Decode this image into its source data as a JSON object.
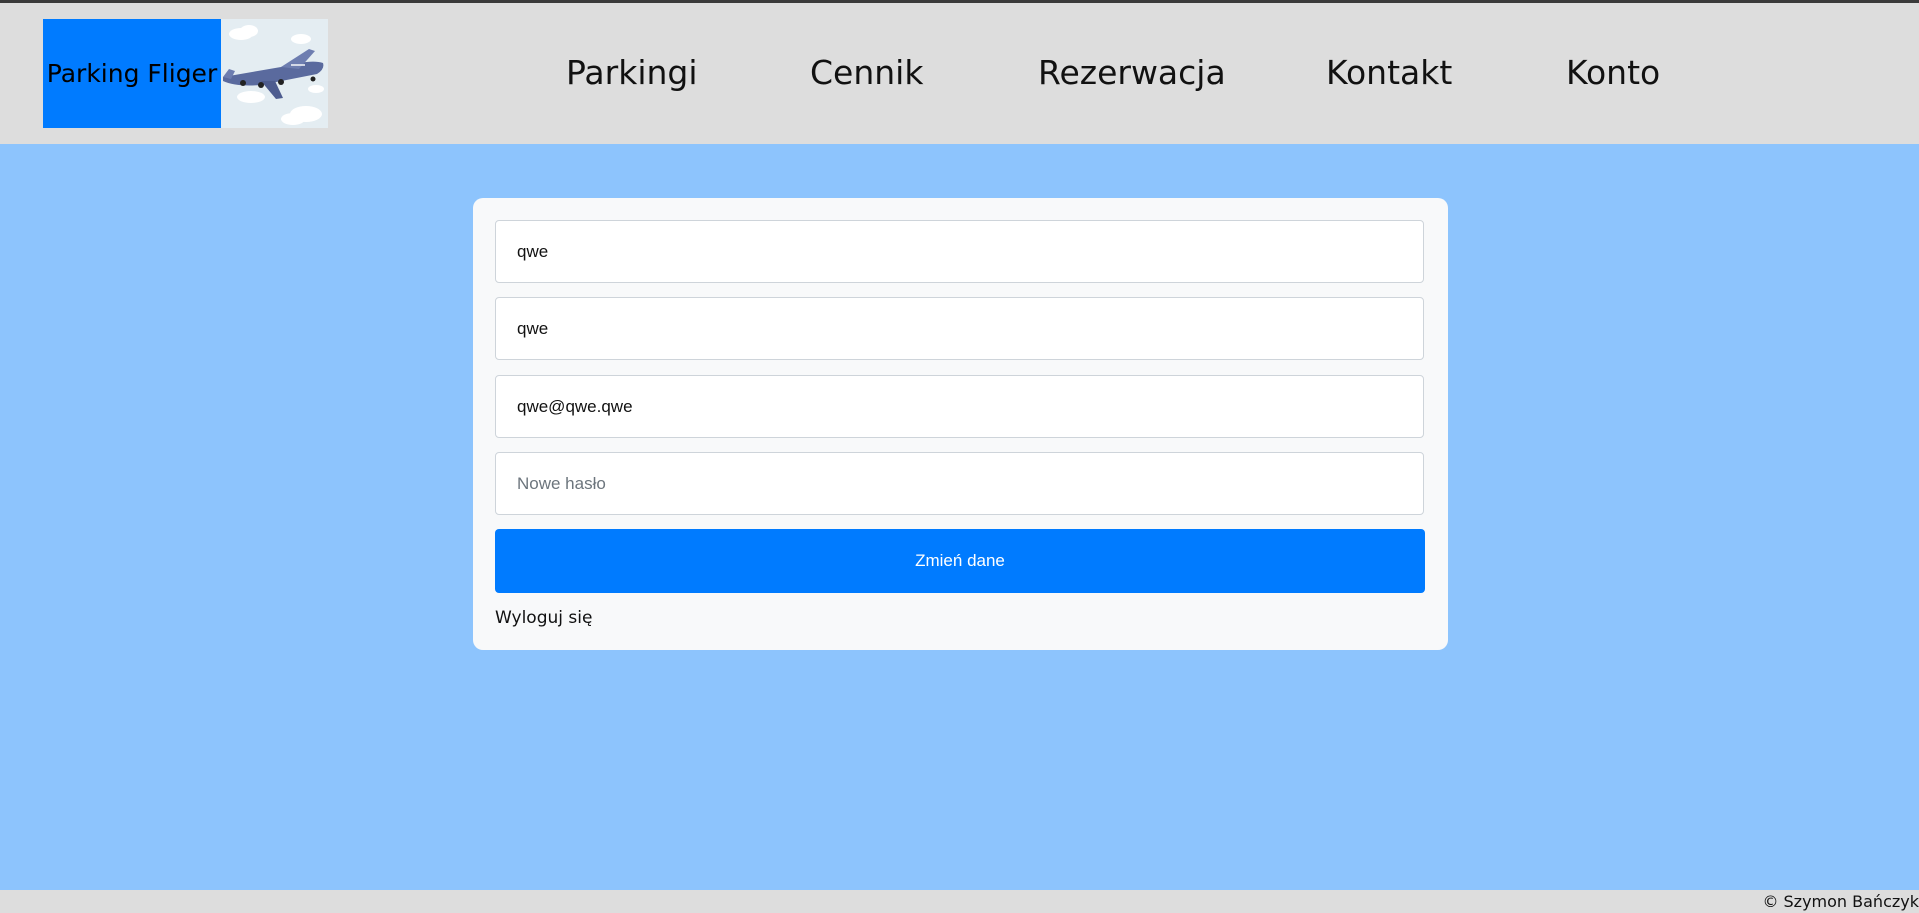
{
  "header": {
    "logo_text": "Parking Fliger",
    "nav": [
      "Parkingi",
      "Cennik",
      "Rezerwacja",
      "Kontakt",
      "Konto"
    ]
  },
  "form": {
    "first_name_value": "qwe",
    "last_name_value": "qwe",
    "email_value": "qwe@qwe.qwe",
    "password_placeholder": "Nowe hasło",
    "submit_label": "Zmień dane",
    "logout_label": "Wyloguj się"
  },
  "footer": {
    "copyright": "© Szymon Bańczyk"
  },
  "colors": {
    "primary": "#007bff",
    "page_bg": "#8dc4fd",
    "header_bg": "#dddddd"
  }
}
